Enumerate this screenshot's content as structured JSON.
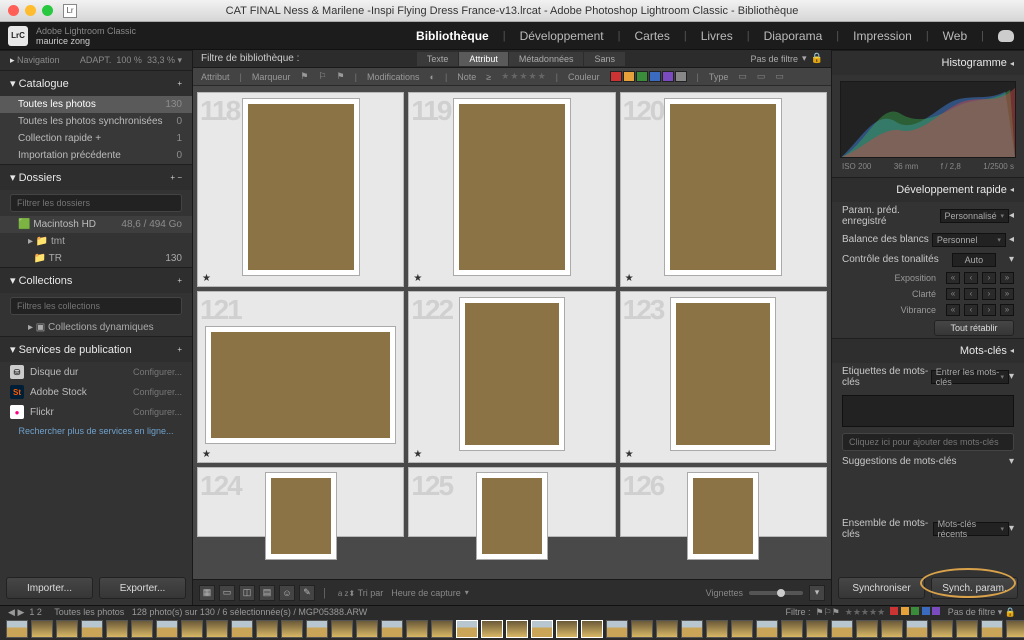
{
  "window": {
    "title": "CAT FINAL Ness & Marilene -Inspi Flying Dress France-v13.lrcat - Adobe Photoshop Lightroom Classic - Bibliothèque"
  },
  "identity": {
    "product": "Adobe Lightroom Classic",
    "user": "maurice zong",
    "logo": "LrC"
  },
  "modules": {
    "items": [
      "Bibliothèque",
      "Développement",
      "Cartes",
      "Livres",
      "Diaporama",
      "Impression",
      "Web"
    ],
    "active": "Bibliothèque"
  },
  "left": {
    "navigation": {
      "title": "Navigation",
      "fit": "ADAPT.",
      "pct": "100 %",
      "zoom": "33,3 %"
    },
    "catalogue": {
      "title": "Catalogue",
      "rows": [
        {
          "label": "Toutes les photos",
          "count": "130",
          "selected": true
        },
        {
          "label": "Toutes les photos synchronisées",
          "count": "0"
        },
        {
          "label": "Collection rapide +",
          "count": "1"
        },
        {
          "label": "Importation précédente",
          "count": "0"
        }
      ]
    },
    "dossiers": {
      "title": "Dossiers",
      "filter_placeholder": "Filtrer les dossiers",
      "volume": {
        "name": "Macintosh HD",
        "info": "48,6 / 494 Go"
      },
      "folders": [
        {
          "name": "tmt",
          "count": ""
        },
        {
          "name": "TR",
          "count": "130"
        }
      ]
    },
    "collections": {
      "title": "Collections",
      "filter_placeholder": "Filtres les collections",
      "smart_label": "Collections dynamiques"
    },
    "publish": {
      "title": "Services de publication",
      "rows": [
        {
          "name": "Disque dur",
          "conf": "Configurer..."
        },
        {
          "name": "Adobe Stock",
          "conf": "Configurer..."
        },
        {
          "name": "Flickr",
          "conf": "Configurer..."
        }
      ],
      "find_more": "Rechercher plus de services en ligne..."
    },
    "buttons": {
      "import": "Importer...",
      "export": "Exporter..."
    }
  },
  "center": {
    "filter_title": "Filtre de bibliothèque :",
    "tabs": [
      "Texte",
      "Attribut",
      "Métadonnées",
      "Sans"
    ],
    "tab_active": "Attribut",
    "preset": "Pas de filtre",
    "attr": {
      "a": "Attribut",
      "marker": "Marqueur",
      "mods": "Modifications",
      "note": "Note",
      "stars": "≥",
      "color": "Couleur",
      "type": "Type",
      "colors": [
        "#c33",
        "#e7a13a",
        "#3a8c3a",
        "#3a6bbf",
        "#7a4bbf",
        "#888"
      ]
    },
    "cells": [
      {
        "idx": "118"
      },
      {
        "idx": "119"
      },
      {
        "idx": "120"
      },
      {
        "idx": "121"
      },
      {
        "idx": "122"
      },
      {
        "idx": "123"
      },
      {
        "idx": "124"
      },
      {
        "idx": "125"
      },
      {
        "idx": "126"
      }
    ],
    "toolbar": {
      "sort_label": "Tri par",
      "sort_value": "Heure de capture",
      "thumb_label": "Vignettes"
    }
  },
  "right": {
    "histogram": {
      "title": "Histogramme",
      "iso": "ISO 200",
      "focal": "36 mm",
      "ap": "f / 2,8",
      "shutter": "1/2500 s"
    },
    "quickdev": {
      "title": "Développement rapide",
      "preset_label": "Param. préd. enregistré",
      "preset_value": "Personnalisé",
      "wb_label": "Balance des blancs",
      "wb_value": "Personnel",
      "tone_label": "Contrôle des tonalités",
      "auto": "Auto",
      "sliders": [
        "Exposition",
        "Clarté",
        "Vibrance"
      ],
      "reset": "Tout rétablir"
    },
    "keywords": {
      "title": "Mots-clés",
      "tags_label": "Etiquettes de mots-clés",
      "tags_value": "Entrer les mots-clés",
      "placeholder": "Cliquez ici pour ajouter des mots-clés",
      "suggestions": "Suggestions de mots-clés",
      "set_label": "Ensemble de mots-clés",
      "set_value": "Mots-clés récents"
    },
    "buttons": {
      "sync": "Synchroniser",
      "sync_settings": "Synch. param."
    }
  },
  "filmstrip": {
    "left_label": "Toutes les photos",
    "info": "128 photo(s) sur 130 / 6 sélectionnée(s) / MGP05388.ARW",
    "filter_label": "Filtre :",
    "nofilter": "Pas de filtre",
    "nav": [
      "1",
      "2"
    ]
  }
}
